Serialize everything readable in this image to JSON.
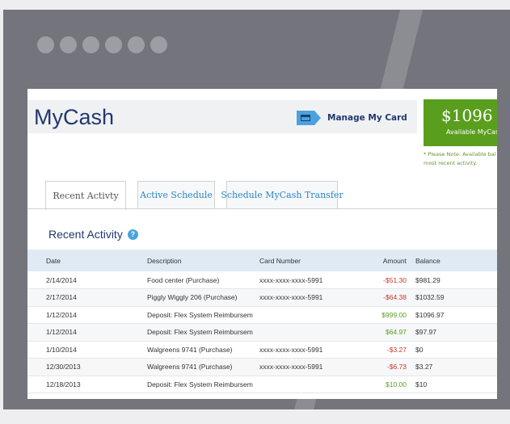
{
  "app": {
    "logo": "MyCash"
  },
  "header": {
    "manage_label": "Manage My Card",
    "balance_amount": "$1096",
    "balance_label": "Available MyCas",
    "note_line1": "* Please Note: Available bal",
    "note_line2": "most recent activity."
  },
  "tabs": [
    {
      "label": "Recent Activty",
      "active": true
    },
    {
      "label": "Active Schedule",
      "active": false
    },
    {
      "label": "Schedule MyCash Transfer",
      "active": false
    }
  ],
  "section": {
    "title": "Recent Activity"
  },
  "table": {
    "headers": [
      "Date",
      "Description",
      "Card Number",
      "Amount",
      "Balance"
    ],
    "rows": [
      [
        "2/14/2014",
        "Food center (Purchase)",
        "xxxx-xxxx-xxxx-5991",
        "-$51.30",
        "$981.29"
      ],
      [
        "2/17/2014",
        "Piggly Wiggly 206 (Purchase)",
        "xxxx-xxxx-xxxx-5991",
        "-$64.38",
        "$1032.59"
      ],
      [
        "1/12/2014",
        "Deposit: Flex System Reimbursem",
        "",
        "$999.00",
        "$1096.97"
      ],
      [
        "1/12/2014",
        "Deposit: Flex System Reimbursem",
        "",
        "$64.97",
        "$97.97"
      ],
      [
        "1/10/2014",
        "Walgreens 9741 (Purchase)",
        "xxxx-xxxx-xxxx-5991",
        "-$3.27",
        "$0"
      ],
      [
        "12/30/2013",
        "Walgreens 9741 (Purchase)",
        "xxxx-xxxx-xxxx-5991",
        "-$6.73",
        "$3.27"
      ],
      [
        "12/18/2013",
        "Deposit: Flex System Reimbursem",
        "",
        "$10.00",
        "$10"
      ]
    ]
  },
  "colors": {
    "brand": "#22386e",
    "accent": "#4aa3df",
    "positive": "#5a9e1e",
    "negative": "#c0392b"
  }
}
